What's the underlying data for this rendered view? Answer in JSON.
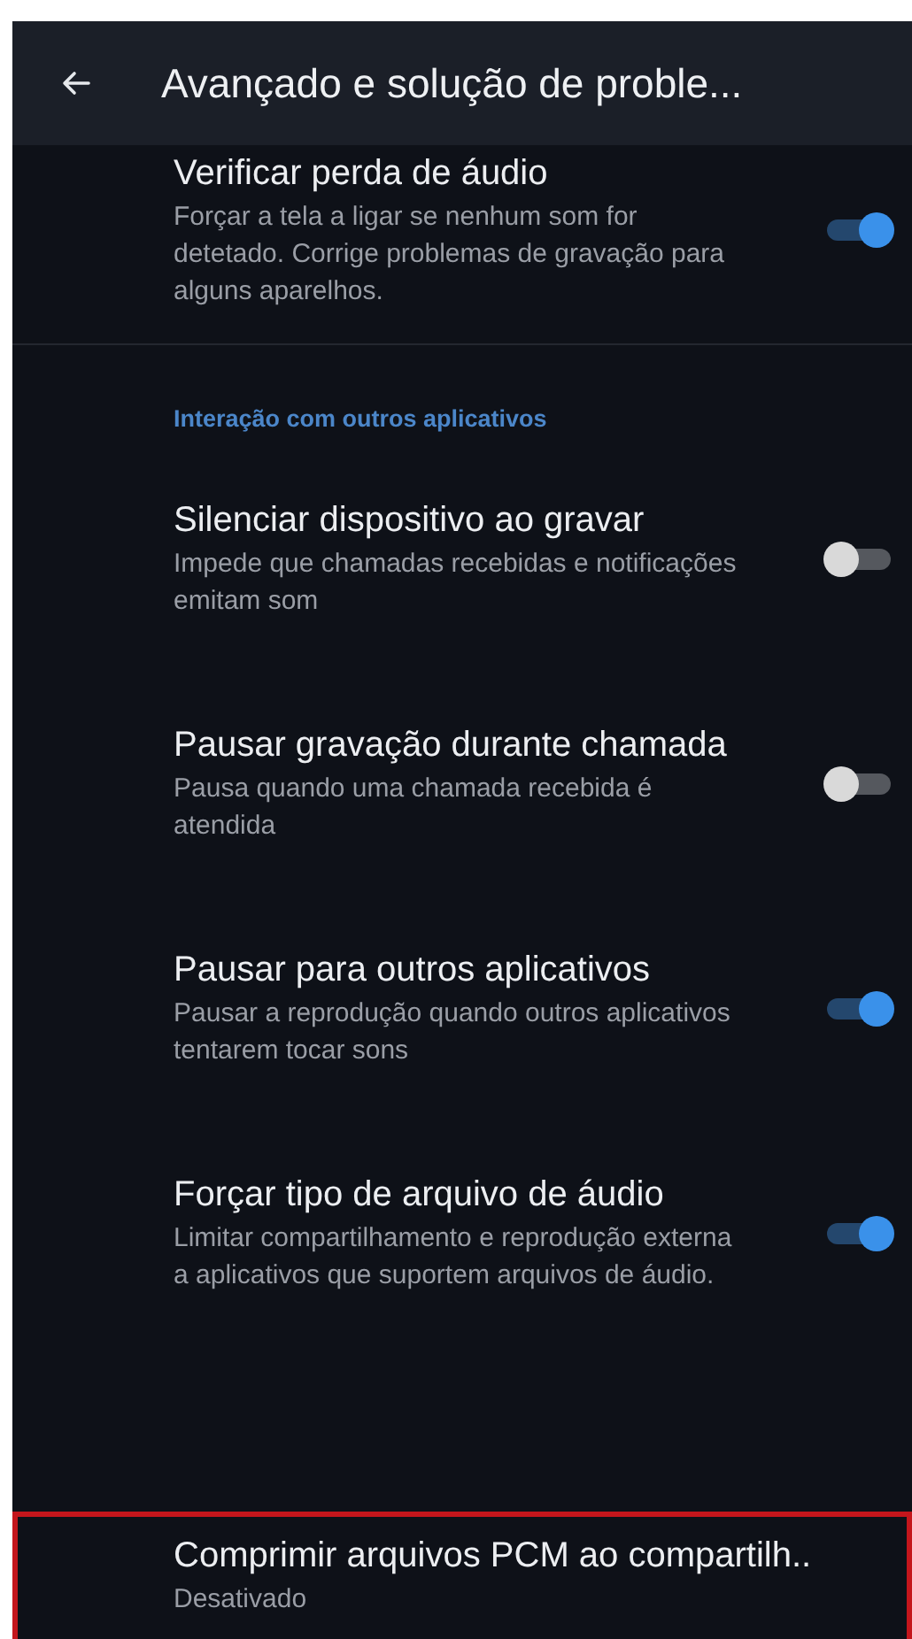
{
  "header": {
    "title": "Avançado e solução de proble..."
  },
  "items": [
    {
      "kind": "switch",
      "title": "Verificar perda de áudio",
      "summary": "Forçar a tela a ligar se nenhum som for detetado. Corrige problemas de gravação para alguns aparelhos.",
      "on": true,
      "highlighted": false
    },
    {
      "kind": "section",
      "title": "Interação com outros aplicativos"
    },
    {
      "kind": "switch",
      "title": "Silenciar dispositivo ao gravar",
      "summary": "Impede que chamadas recebidas e notificações emitam som",
      "on": false,
      "highlighted": false
    },
    {
      "kind": "switch",
      "title": "Pausar gravação durante chamada",
      "summary": "Pausa quando uma chamada recebida é atendida",
      "on": false,
      "highlighted": false
    },
    {
      "kind": "switch",
      "title": "Pausar para outros aplicativos",
      "summary": "Pausar a reprodução quando outros aplicativos tentarem tocar sons",
      "on": true,
      "highlighted": false
    },
    {
      "kind": "switch",
      "title": "Forçar tipo de arquivo de áudio",
      "summary": "Limitar compartilhamento e reprodução externa a aplicativos que suportem arquivos de áudio.",
      "on": true,
      "highlighted": false
    },
    {
      "kind": "value",
      "title": "Comprimir arquivos PCM ao compartilh..",
      "summary": "Desativado",
      "highlighted": true
    }
  ]
}
